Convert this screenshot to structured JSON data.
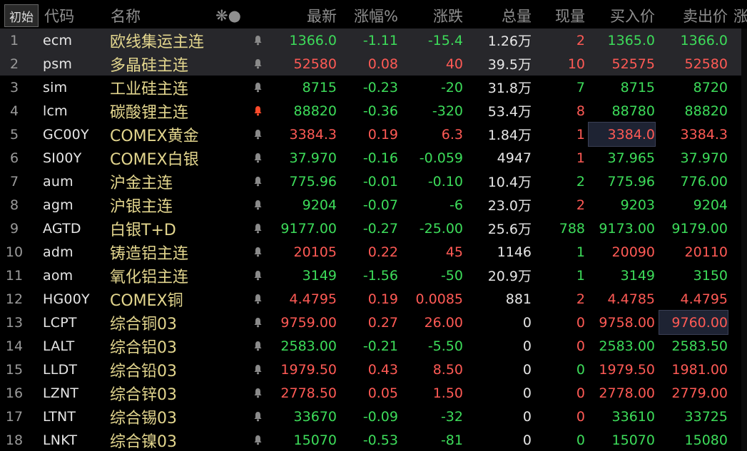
{
  "header": {
    "tab_label": "初始",
    "icons": "❋●",
    "columns": {
      "code": "代码",
      "name": "名称",
      "last": "最新",
      "pct": "涨幅%",
      "chg": "涨跌",
      "vol": "总量",
      "cur": "现量",
      "bid": "买入价",
      "ask": "卖出价",
      "extra": "涨"
    }
  },
  "colors": {
    "up": "#ff5a55",
    "down": "#3ddc5a",
    "name": "#e3d68e",
    "bell_active": "#ff4b2b",
    "bell_inactive": "#8a8a8a"
  },
  "rows": [
    {
      "num": "1",
      "code": "ecm",
      "name": "欧线集运主连",
      "bell": "inactive",
      "last": "1366.0",
      "pct": "-1.11",
      "chg": "-15.4",
      "vol": "1.26万",
      "cur": "2",
      "bid": "1365.0",
      "ask": "1366.0",
      "dir": "down",
      "cur_dir": "up",
      "bid_dir": "down",
      "ask_dir": "down",
      "highlight": true
    },
    {
      "num": "2",
      "code": "psm",
      "name": "多晶硅主连",
      "bell": "inactive",
      "last": "52580",
      "pct": "0.08",
      "chg": "40",
      "vol": "39.5万",
      "cur": "10",
      "bid": "52575",
      "ask": "52580",
      "dir": "up",
      "cur_dir": "up",
      "bid_dir": "up",
      "ask_dir": "up",
      "highlight": true
    },
    {
      "num": "3",
      "code": "sim",
      "name": "工业硅主连",
      "bell": "inactive",
      "last": "8715",
      "pct": "-0.23",
      "chg": "-20",
      "vol": "31.8万",
      "cur": "7",
      "bid": "8715",
      "ask": "8720",
      "dir": "down",
      "cur_dir": "down",
      "bid_dir": "down",
      "ask_dir": "down"
    },
    {
      "num": "4",
      "code": "lcm",
      "name": "碳酸锂主连",
      "bell": "active",
      "last": "88820",
      "pct": "-0.36",
      "chg": "-320",
      "vol": "53.4万",
      "cur": "8",
      "bid": "88780",
      "ask": "88820",
      "dir": "down",
      "cur_dir": "up",
      "bid_dir": "down",
      "ask_dir": "down"
    },
    {
      "num": "5",
      "code": "GC00Y",
      "name": "COMEX黄金",
      "bell": "inactive",
      "last": "3384.3",
      "pct": "0.19",
      "chg": "6.3",
      "vol": "1.84万",
      "cur": "1",
      "bid": "3384.0",
      "ask": "3384.3",
      "dir": "up",
      "cur_dir": "up",
      "bid_dir": "up",
      "ask_dir": "up",
      "bid_box": true
    },
    {
      "num": "6",
      "code": "SI00Y",
      "name": "COMEX白银",
      "bell": "inactive",
      "last": "37.970",
      "pct": "-0.16",
      "chg": "-0.059",
      "vol": "4947",
      "cur": "1",
      "bid": "37.965",
      "ask": "37.970",
      "dir": "down",
      "cur_dir": "up",
      "bid_dir": "down",
      "ask_dir": "down"
    },
    {
      "num": "7",
      "code": "aum",
      "name": "沪金主连",
      "bell": "inactive",
      "last": "775.96",
      "pct": "-0.01",
      "chg": "-0.10",
      "vol": "10.4万",
      "cur": "2",
      "bid": "775.96",
      "ask": "776.00",
      "dir": "down",
      "cur_dir": "down",
      "bid_dir": "down",
      "ask_dir": "down"
    },
    {
      "num": "8",
      "code": "agm",
      "name": "沪银主连",
      "bell": "inactive",
      "last": "9204",
      "pct": "-0.07",
      "chg": "-6",
      "vol": "23.0万",
      "cur": "2",
      "bid": "9203",
      "ask": "9204",
      "dir": "down",
      "cur_dir": "up",
      "bid_dir": "down",
      "ask_dir": "down"
    },
    {
      "num": "9",
      "code": "AGTD",
      "name": "白银T+D",
      "bell": "inactive",
      "last": "9177.00",
      "pct": "-0.27",
      "chg": "-25.00",
      "vol": "25.6万",
      "cur": "788",
      "bid": "9173.00",
      "ask": "9179.00",
      "dir": "down",
      "cur_dir": "down",
      "bid_dir": "down",
      "ask_dir": "down"
    },
    {
      "num": "10",
      "code": "adm",
      "name": "铸造铝主连",
      "bell": "inactive",
      "last": "20105",
      "pct": "0.22",
      "chg": "45",
      "vol": "1146",
      "cur": "1",
      "bid": "20090",
      "ask": "20110",
      "dir": "up",
      "cur_dir": "down",
      "bid_dir": "up",
      "ask_dir": "up"
    },
    {
      "num": "11",
      "code": "aom",
      "name": "氧化铝主连",
      "bell": "inactive",
      "last": "3149",
      "pct": "-1.56",
      "chg": "-50",
      "vol": "20.9万",
      "cur": "1",
      "bid": "3149",
      "ask": "3150",
      "dir": "down",
      "cur_dir": "down",
      "bid_dir": "down",
      "ask_dir": "down"
    },
    {
      "num": "12",
      "code": "HG00Y",
      "name": "COMEX铜",
      "bell": "inactive",
      "last": "4.4795",
      "pct": "0.19",
      "chg": "0.0085",
      "vol": "881",
      "cur": "2",
      "bid": "4.4785",
      "ask": "4.4795",
      "dir": "up",
      "cur_dir": "up",
      "bid_dir": "up",
      "ask_dir": "up"
    },
    {
      "num": "13",
      "code": "LCPT",
      "name": "综合铜03",
      "bell": "inactive",
      "last": "9759.00",
      "pct": "0.27",
      "chg": "26.00",
      "vol": "0",
      "cur": "0",
      "bid": "9758.00",
      "ask": "9760.00",
      "dir": "up",
      "cur_dir": "up",
      "bid_dir": "up",
      "ask_dir": "up",
      "ask_box": true
    },
    {
      "num": "14",
      "code": "LALT",
      "name": "综合铝03",
      "bell": "inactive",
      "last": "2583.00",
      "pct": "-0.21",
      "chg": "-5.50",
      "vol": "0",
      "cur": "0",
      "bid": "2583.00",
      "ask": "2583.50",
      "dir": "down",
      "cur_dir": "up",
      "bid_dir": "down",
      "ask_dir": "down"
    },
    {
      "num": "15",
      "code": "LLDT",
      "name": "综合铅03",
      "bell": "inactive",
      "last": "1979.50",
      "pct": "0.43",
      "chg": "8.50",
      "vol": "0",
      "cur": "0",
      "bid": "1979.50",
      "ask": "1981.00",
      "dir": "up",
      "cur_dir": "down",
      "bid_dir": "up",
      "ask_dir": "up"
    },
    {
      "num": "16",
      "code": "LZNT",
      "name": "综合锌03",
      "bell": "inactive",
      "last": "2778.50",
      "pct": "0.05",
      "chg": "1.50",
      "vol": "0",
      "cur": "0",
      "bid": "2778.00",
      "ask": "2779.00",
      "dir": "up",
      "cur_dir": "up",
      "bid_dir": "up",
      "ask_dir": "up"
    },
    {
      "num": "17",
      "code": "LTNT",
      "name": "综合锡03",
      "bell": "inactive",
      "last": "33670",
      "pct": "-0.09",
      "chg": "-32",
      "vol": "0",
      "cur": "0",
      "bid": "33610",
      "ask": "33725",
      "dir": "down",
      "cur_dir": "up",
      "bid_dir": "down",
      "ask_dir": "down"
    },
    {
      "num": "18",
      "code": "LNKT",
      "name": "综合镍03",
      "bell": "inactive",
      "last": "15070",
      "pct": "-0.53",
      "chg": "-81",
      "vol": "0",
      "cur": "0",
      "bid": "15070",
      "ask": "15080",
      "dir": "down",
      "cur_dir": "down",
      "bid_dir": "down",
      "ask_dir": "down"
    }
  ]
}
